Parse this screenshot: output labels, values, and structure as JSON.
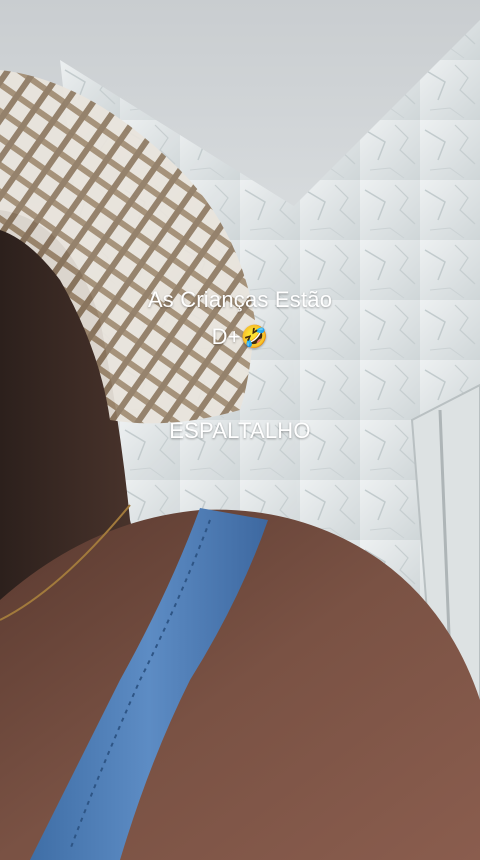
{
  "captions": {
    "line1": "As Crianças Estão",
    "line2_text": "D+",
    "line2_emoji": "🤣",
    "line3": "ESPALTALHO"
  },
  "scene": {
    "description_icons": [
      "straw-hat",
      "denim-overalls-strap"
    ],
    "colors": {
      "wall": "#dfe4e6",
      "ceiling": "#d3d6d8",
      "skin": "#6b4a3d",
      "denim": "#4e7db5",
      "straw": "#b8a58a"
    }
  }
}
